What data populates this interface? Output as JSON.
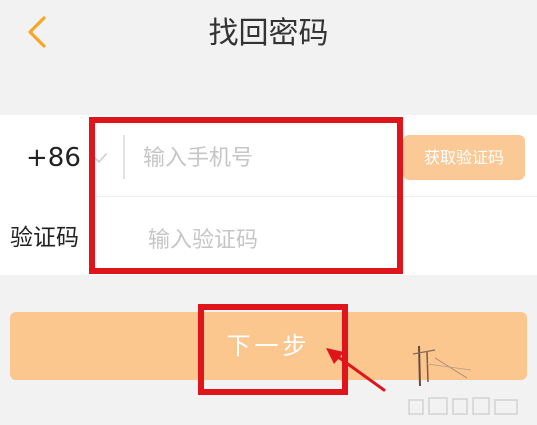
{
  "header": {
    "title": "找回密码",
    "back_icon": "chevron-left-icon"
  },
  "form": {
    "country_code": "+86",
    "country_chevron_icon": "chevron-down-icon",
    "phone_placeholder": "输入手机号",
    "get_code_label": "获取验证码",
    "code_label": "验证码",
    "code_placeholder": "输入验证码"
  },
  "next": {
    "label": "下一步"
  },
  "annotation": {
    "highlight_color": "#e0141b"
  },
  "colors": {
    "accent": "#f5a623",
    "button_fill": "#fcc68f",
    "get_code_fill": "#fbc996",
    "background": "#f2f2f2"
  }
}
